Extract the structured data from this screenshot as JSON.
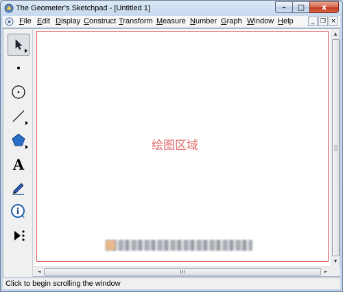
{
  "window": {
    "title": "The Geometer's Sketchpad - [Untitled 1]",
    "minimize_glyph": "–",
    "maximize_glyph": "□",
    "close_glyph": "x"
  },
  "menu": [
    {
      "accel": "F",
      "rest": "ile"
    },
    {
      "accel": "E",
      "rest": "dit"
    },
    {
      "accel": "D",
      "rest": "isplay"
    },
    {
      "accel": "C",
      "rest": "onstruct"
    },
    {
      "accel": "T",
      "rest": "ransform"
    },
    {
      "accel": "M",
      "rest": "easure"
    },
    {
      "accel": "N",
      "rest": "umber"
    },
    {
      "accel": "G",
      "rest": "raph"
    },
    {
      "accel": "W",
      "rest": "indow"
    },
    {
      "accel": "H",
      "rest": "elp"
    }
  ],
  "mdi": {
    "minimize": "_",
    "restore": "❐",
    "close": "×"
  },
  "toolbox": {
    "tools": [
      "arrow-select-tool",
      "point-tool",
      "compass-tool",
      "straightedge-tool",
      "polygon-tool",
      "text-tool",
      "marker-tool",
      "information-tool",
      "custom-tool"
    ],
    "text_tool_glyph": "A",
    "info_tool_glyph": "i",
    "active": "arrow-select-tool"
  },
  "canvas": {
    "label": "绘图区域",
    "label_color": "#e06b6b",
    "frame_color": "#e05a5a"
  },
  "scrollbar": {
    "up": "▲",
    "down": "▼",
    "left": "◄",
    "right": "►"
  },
  "status": {
    "text": "Click to begin scrolling the window"
  }
}
